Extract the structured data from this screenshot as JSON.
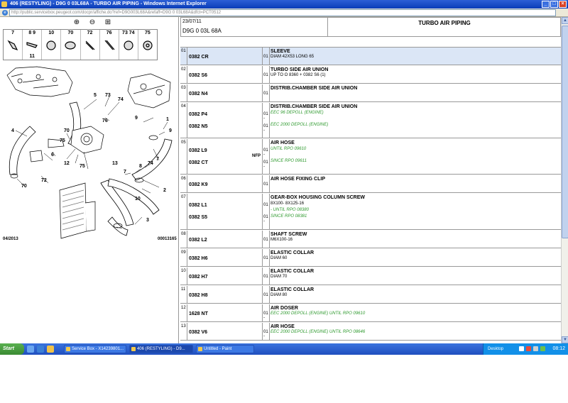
{
  "window": {
    "title": "406 (RESTYLING) - D9G 0 03L68A - TURBO AIR PIPING - Windows Internet Explorer",
    "url": "http://public.servicebox.peugeot.com/docpr/affiche.do?ref=D9G003L68A&refaff=D9G 0 03L68A&dfct=PCT0512"
  },
  "diagram": {
    "zoom_in_icon": "zoom-in-icon",
    "zoom_out_icon": "zoom-out-icon",
    "zoom_fit_icon": "zoom-fit-icon",
    "parts_strip": [
      {
        "top": "7",
        "bottom": ""
      },
      {
        "top": "8 9",
        "bottom": "11"
      },
      {
        "top": "10",
        "bottom": ""
      },
      {
        "top": "70",
        "bottom": ""
      },
      {
        "top": "72",
        "bottom": ""
      },
      {
        "top": "76",
        "bottom": ""
      },
      {
        "top": "73 74",
        "bottom": ""
      },
      {
        "top": "75",
        "bottom": ""
      }
    ],
    "callouts": {
      "c1": "1",
      "c2": "2",
      "c3": "3",
      "c4": "4",
      "c5": "5",
      "c6": "6",
      "c7": "7",
      "c8": "8",
      "c9": "9",
      "c10": "10",
      "c11": "11",
      "c12": "12",
      "c13": "13",
      "c70a": "70",
      "c70b": "70",
      "c72": "72",
      "c73": "73",
      "c74a": "74",
      "c74b": "74",
      "c75a": "75",
      "c75b": "75",
      "c76": "76"
    },
    "footer_date": "04/2013",
    "footer_ref": "00013165"
  },
  "header": {
    "date": "23/07/11",
    "model": "D9G 0 03L 68A",
    "title": "TURBO AIR PIPING"
  },
  "parts": [
    {
      "idx": "01",
      "selected": true,
      "name": "SLEEVE",
      "refs": [
        "0382 CR"
      ],
      "qtys": [
        "01"
      ],
      "lines": [
        {
          "text": "DIAM 42X53 LONG 65",
          "green": false
        }
      ]
    },
    {
      "idx": "02",
      "selected": false,
      "name": "TURBO SIDE AIR UNION",
      "refs": [
        "0382 S6"
      ],
      "qtys": [
        "01"
      ],
      "lines": [
        {
          "text": "UP TO O 8360 + 0382 S6 (1)",
          "green": false
        }
      ]
    },
    {
      "idx": "03",
      "selected": false,
      "name": "DISTRIB.CHAMBER SIDE AIR UNION",
      "refs": [
        "0382 N4"
      ],
      "qtys": [
        "01"
      ],
      "lines": []
    },
    {
      "idx": "04",
      "selected": false,
      "name": "DISTRIB.CHAMBER SIDE AIR UNION",
      "refs": [
        "0382 P4",
        "0382 N5"
      ],
      "qtys": [
        "01 -",
        "01 -"
      ],
      "lines": [
        {
          "text": "EEC 96 DEPOLL (ENGINE)",
          "green": true
        },
        {
          "text": "EEC 2000 DEPOLL (ENGINE)",
          "green": true
        }
      ]
    },
    {
      "idx": "05",
      "selected": false,
      "name": "AIR HOSE",
      "refs": [
        "0382 L9",
        "0382 CT"
      ],
      "qtys": [
        "01 -",
        "01 -"
      ],
      "nfp": "NFP",
      "lines": [
        {
          "text": "UNTIL RPO 09610",
          "green": true
        },
        {
          "text": "SINCE RPO 09611",
          "green": true
        }
      ]
    },
    {
      "idx": "06",
      "selected": false,
      "name": "AIR HOSE FIXING CLIP",
      "refs": [
        "0382 K9"
      ],
      "qtys": [
        "01"
      ],
      "lines": []
    },
    {
      "idx": "07",
      "selected": false,
      "name": "GEAR-BOX HOUSING COLUMN SCREW",
      "refs": [
        "0382 L1",
        "0382 S5"
      ],
      "qtys": [
        "01",
        "01 -"
      ],
      "lines": [
        {
          "text": "8X100- 8X125-16",
          "green": false
        },
        {
          "text": "- UNTIL RPO 08380",
          "green": true
        },
        {
          "text": "SINCE RPO 08381",
          "green": true
        }
      ]
    },
    {
      "idx": "08",
      "selected": false,
      "name": "SHAFT SCREW",
      "refs": [
        "0382 L2"
      ],
      "qtys": [
        "01"
      ],
      "lines": [
        {
          "text": "M6X100-16",
          "green": false
        }
      ]
    },
    {
      "idx": "09",
      "selected": false,
      "name": "ELASTIC COLLAR",
      "refs": [
        "0382 H6"
      ],
      "qtys": [
        "01"
      ],
      "lines": [
        {
          "text": "DIAM 60",
          "green": false
        }
      ]
    },
    {
      "idx": "10",
      "selected": false,
      "name": "ELASTIC COLLAR",
      "refs": [
        "0382 H7"
      ],
      "qtys": [
        "01"
      ],
      "lines": [
        {
          "text": "DIAM 70",
          "green": false
        }
      ]
    },
    {
      "idx": "11",
      "selected": false,
      "name": "ELASTIC COLLAR",
      "refs": [
        "0382 H8"
      ],
      "qtys": [
        "01"
      ],
      "lines": [
        {
          "text": "DIAM 80",
          "green": false
        }
      ]
    },
    {
      "idx": "12",
      "selected": false,
      "name": "AIR DOSER",
      "refs": [
        "1628 NT"
      ],
      "qtys": [
        "01 -"
      ],
      "lines": [
        {
          "text": "EEC 2000 DEPOLL (ENGINE) UNTIL RPO 09610",
          "green": true
        }
      ]
    },
    {
      "idx": "13",
      "selected": false,
      "name": "AIR HOSE",
      "refs": [
        "0382 V6"
      ],
      "qtys": [
        "01 -"
      ],
      "lines": [
        {
          "text": "EEC 2000 DEPOLL (ENGINE) UNTIL RPO 08646",
          "green": true
        }
      ]
    }
  ],
  "taskbar": {
    "start_label": "Start",
    "tasks": [
      {
        "label": "Service Box - X14239801...",
        "active": false
      },
      {
        "label": "406 (RESTYLING) - D9...",
        "active": true
      },
      {
        "label": "Untitled - Paint",
        "active": false
      }
    ],
    "desktop_label": "Desktop",
    "clock": "08:12"
  },
  "colors": {
    "selected_row": "#dbe6f6",
    "green_note": "#2f9a2f",
    "taskbar": "#2a5fcf"
  }
}
